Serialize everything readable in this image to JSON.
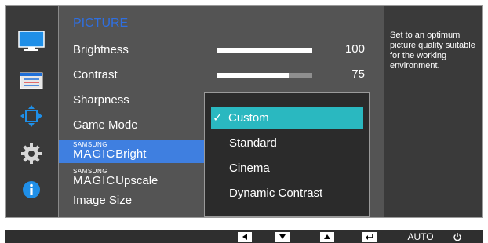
{
  "menu": {
    "title": "PICTURE",
    "items": [
      {
        "label": "Brightness"
      },
      {
        "label": "Contrast"
      },
      {
        "label": "Sharpness"
      },
      {
        "label": "Game Mode"
      },
      {
        "prefix_small": "SAMSUNG",
        "prefix_big": "MAGIC",
        "label": "Bright"
      },
      {
        "prefix_small": "SAMSUNG",
        "prefix_big": "MAGIC",
        "label": "Upscale"
      },
      {
        "label": "Image Size"
      }
    ],
    "selected_item": "Bright"
  },
  "sliders": [
    {
      "name": "Brightness",
      "value": 100,
      "display": "100",
      "max": 100
    },
    {
      "name": "Contrast",
      "value": 75,
      "display": "75",
      "max": 100
    }
  ],
  "dropdown": {
    "options": [
      "Custom",
      "Standard",
      "Cinema",
      "Dynamic Contrast"
    ],
    "selected": "Custom",
    "check_glyph": "✓"
  },
  "description": "Set to an optimum picture quality suitable for the working environment.",
  "sidebar_icons": [
    "monitor-icon",
    "settings-list-icon",
    "move-arrows-icon",
    "gear-icon",
    "info-icon"
  ],
  "bottom_buttons": [
    {
      "icon": "left-arrow-icon"
    },
    {
      "icon": "down-arrow-icon"
    },
    {
      "icon": "up-arrow-icon"
    },
    {
      "icon": "enter-icon"
    },
    {
      "label": "AUTO"
    },
    {
      "icon": "power-icon"
    }
  ],
  "colors": {
    "title_blue": "#2f6fe0",
    "selected_blue": "#3f7fe0",
    "dropdown_cyan": "#2ab8c0",
    "panel_gray": "#545454"
  }
}
